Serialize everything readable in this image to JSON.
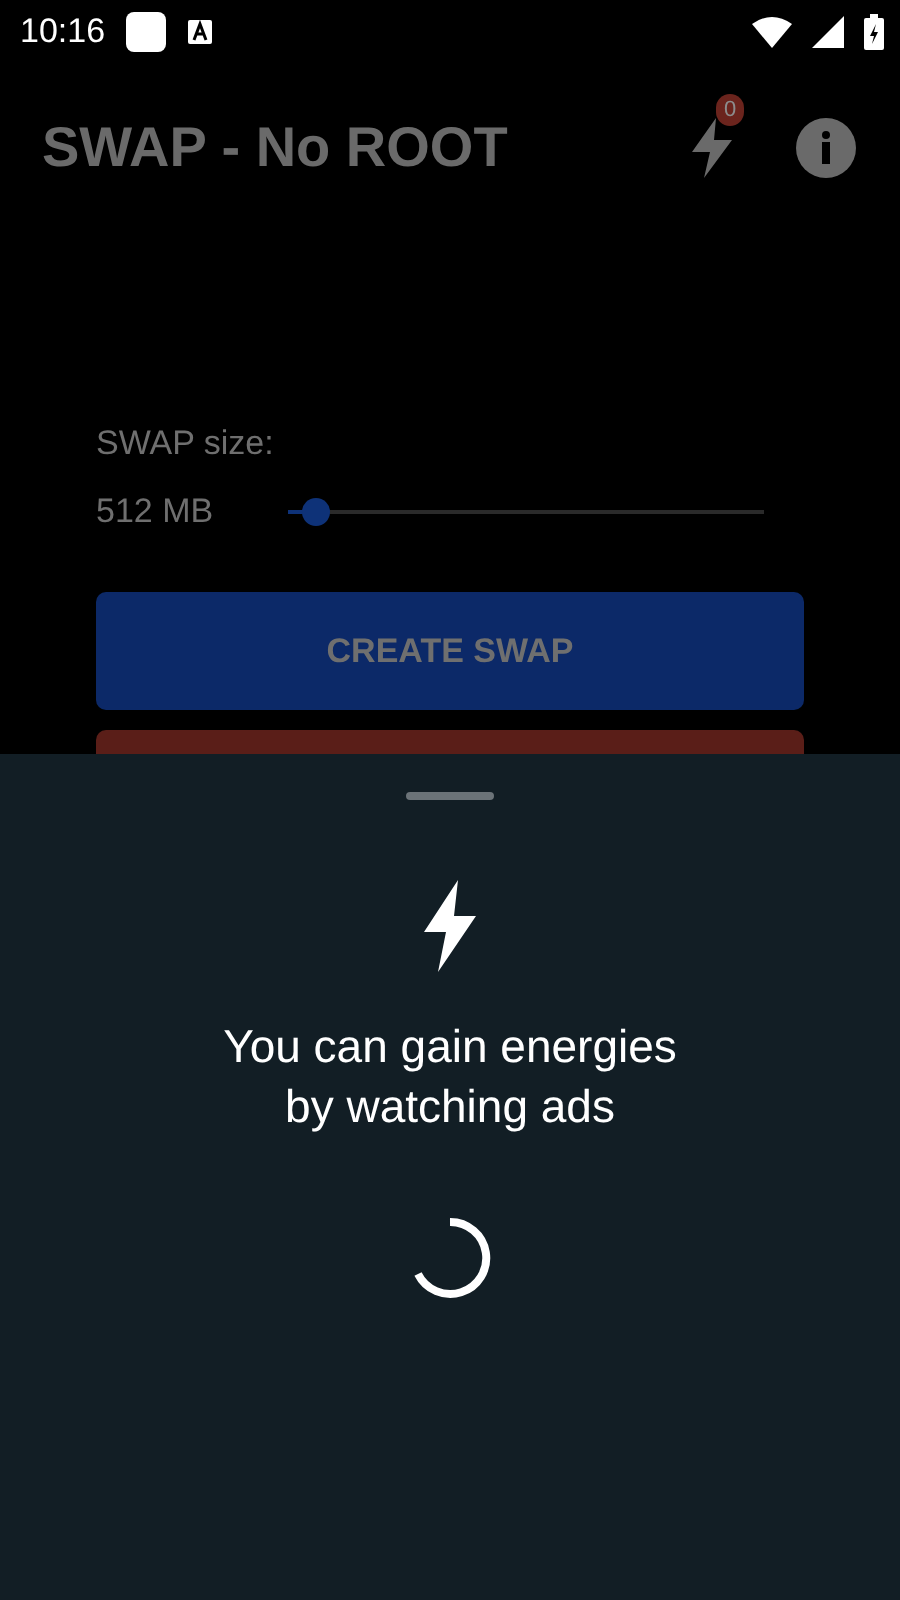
{
  "status_bar": {
    "time": "10:16"
  },
  "app_bar": {
    "title": "SWAP - No ROOT",
    "energy_count": "0"
  },
  "swap": {
    "label": "SWAP size:",
    "value": "512 MB",
    "level": 0.06
  },
  "buttons": [
    {
      "label": "CREATE SWAP",
      "kind": "primary"
    },
    {
      "kind": "danger"
    }
  ],
  "sheet": {
    "message": "You can gain energies by watching ads",
    "loading": true
  }
}
